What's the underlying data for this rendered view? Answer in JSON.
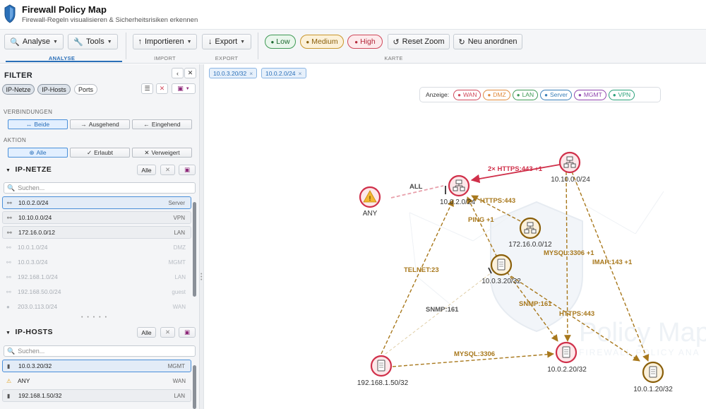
{
  "app": {
    "title": "Firewall Policy Map",
    "subtitle": "Firewall-Regeln visualisieren & Sicherheitsrisiken erkennen"
  },
  "toolbar": {
    "analyse": "Analyse",
    "tools": "Tools",
    "importieren": "Importieren",
    "export": "Export",
    "low": "Low",
    "medium": "Medium",
    "high": "High",
    "reset_zoom": "Reset Zoom",
    "neu_anordnen": "Neu anordnen",
    "group_analyse": "ANALYSE",
    "group_import": "IMPORT",
    "group_export": "EXPORT",
    "group_karte": "KARTE"
  },
  "filter": {
    "title": "FILTER",
    "chips": [
      "IP-Netze",
      "IP-Hosts",
      "Ports"
    ],
    "verbindungen_label": "VERBINDUNGEN",
    "verbindungen": [
      "Beide",
      "Ausgehend",
      "Eingehend"
    ],
    "aktion_label": "AKTION",
    "aktion": [
      "Alle",
      "Erlaubt",
      "Verweigert"
    ]
  },
  "ip_netze": {
    "title": "IP-NETZE",
    "alle": "Alle",
    "search_placeholder": "Suchen...",
    "items": [
      {
        "name": "10.0.2.0/24",
        "tag": "Server"
      },
      {
        "name": "10.10.0.0/24",
        "tag": "VPN"
      },
      {
        "name": "172.16.0.0/12",
        "tag": "LAN"
      },
      {
        "name": "10.0.1.0/24",
        "tag": "DMZ"
      },
      {
        "name": "10.0.3.0/24",
        "tag": "MGMT"
      },
      {
        "name": "192.168.1.0/24",
        "tag": "LAN"
      },
      {
        "name": "192.168.50.0/24",
        "tag": "guest"
      },
      {
        "name": "203.0.113.0/24",
        "tag": "WAN"
      }
    ]
  },
  "ip_hosts": {
    "title": "IP-HOSTS",
    "alle": "Alle",
    "search_placeholder": "Suchen...",
    "items": [
      {
        "name": "10.0.3.20/32",
        "tag": "MGMT"
      },
      {
        "name": "ANY",
        "tag": "WAN"
      },
      {
        "name": "192.168.1.50/32",
        "tag": "LAN"
      }
    ]
  },
  "map": {
    "filter_chips": [
      "10.0.3.20/32",
      "10.0.2.0/24"
    ],
    "legend_label": "Anzeige:",
    "legend": [
      {
        "label": "WAN",
        "color": "#d0485a"
      },
      {
        "label": "DMZ",
        "color": "#e08a3c"
      },
      {
        "label": "LAN",
        "color": "#3f9a55"
      },
      {
        "label": "Server",
        "color": "#3a7fb8"
      },
      {
        "label": "MGMT",
        "color": "#8e44ad"
      },
      {
        "label": "VPN",
        "color": "#2aa17a"
      }
    ],
    "watermark": [
      "Policy Map",
      "FIREWALL POLICY ANA"
    ],
    "nodes": [
      {
        "label": "ANY",
        "risk": "warning"
      },
      {
        "label": "10.0.2.0/24",
        "risk": "high"
      },
      {
        "label": "10.10.0.0/24",
        "risk": "high"
      },
      {
        "label": "172.16.0.0/12",
        "risk": "medium"
      },
      {
        "label": "10.0.3.20/32",
        "risk": "medium"
      },
      {
        "label": "192.168.1.50/32",
        "risk": "high"
      },
      {
        "label": "10.0.2.20/32",
        "risk": "high"
      },
      {
        "label": "10.0.1.20/32",
        "risk": "medium"
      }
    ],
    "edges": [
      {
        "label": "ALL"
      },
      {
        "label": "2× HTTPS:443 +1"
      },
      {
        "label": "HTTPS:443"
      },
      {
        "label": "PING +1"
      },
      {
        "label": "TELNET:23"
      },
      {
        "label": "MYSQL:3306 +1"
      },
      {
        "label": "IMAP:143 +1"
      },
      {
        "label": "SNMP:161"
      },
      {
        "label": "SNMP:161"
      },
      {
        "label": "HTTPS:443"
      },
      {
        "label": "MYSQL:3306"
      }
    ]
  }
}
